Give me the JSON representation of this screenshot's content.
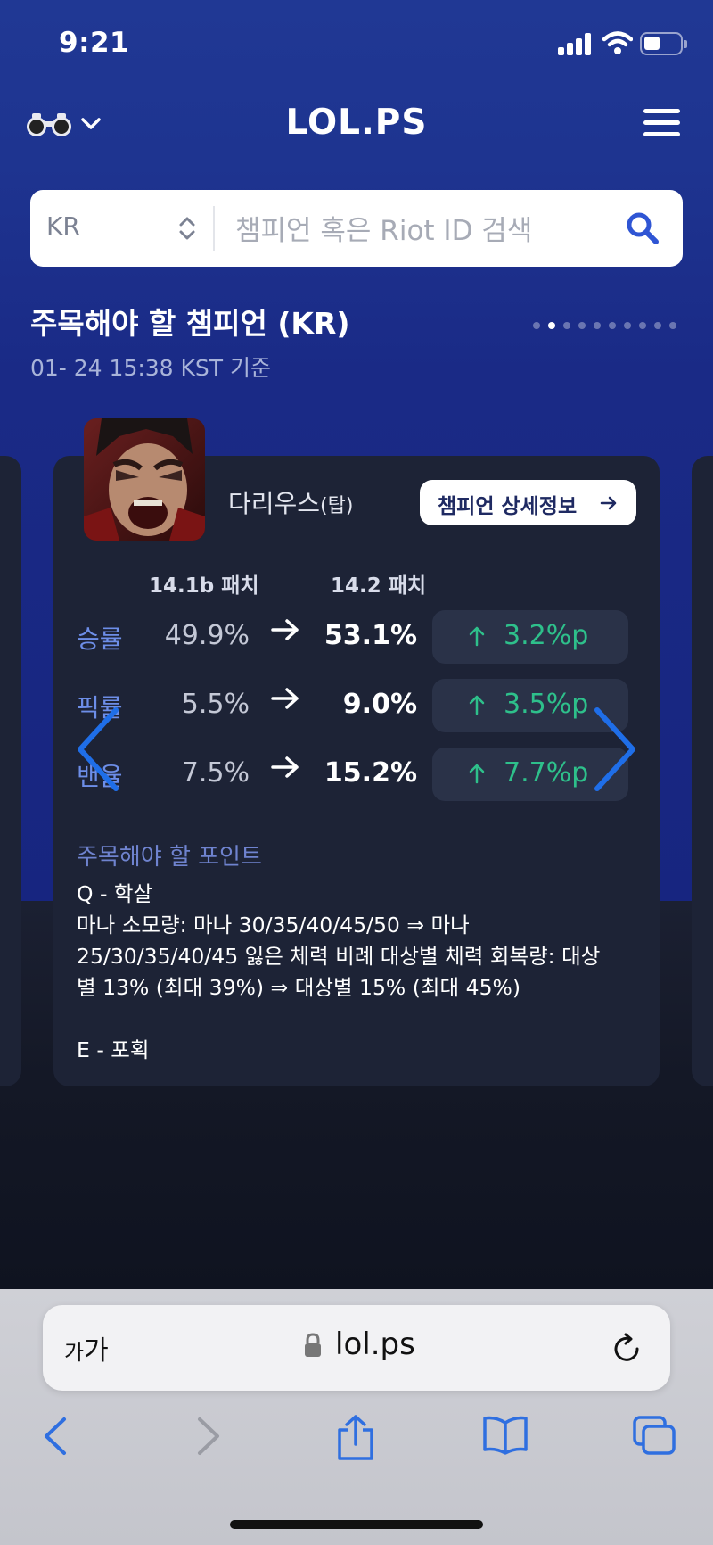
{
  "status_bar": {
    "time": "9:21",
    "battery_percent": 40
  },
  "header": {
    "logo": "LOL.PS",
    "icons": [
      "binoculars-icon",
      "chevron-down-icon",
      "menu-icon"
    ]
  },
  "search": {
    "region": "KR",
    "placeholder": "챔피언 혹은 Riot ID 검색"
  },
  "section": {
    "title": "주목해야 할 챔피언 (KR)",
    "updated": "01- 24 15:38 KST 기준",
    "page_dots": 10,
    "active_dot": 2
  },
  "card": {
    "champion_name": "다리우스",
    "champion_role": "(탑)",
    "detail_button": "챔피언 상세정보",
    "patch_old": "14.1b 패치",
    "patch_new": "14.2 패치",
    "stats": [
      {
        "label": "승률",
        "old": "49.9%",
        "new": "53.1%",
        "delta": "3.2%p"
      },
      {
        "label": "픽률",
        "old": "5.5%",
        "new": "9.0%",
        "delta": "3.5%p"
      },
      {
        "label": "밴율",
        "old": "7.5%",
        "new": "15.2%",
        "delta": "7.7%p"
      }
    ],
    "points_title": "주목해야 할 포인트",
    "notes": [
      "Q - 학살",
      "마나 소모량: 마나 30/35/40/45/50 ⇒ 마나",
      "25/30/35/40/45 잃은 체력 비례 대상별 체력 회복량: 대상",
      "별 13% (최대 39%) ⇒ 대상별 15% (최대 45%)",
      "",
      "E - 포획"
    ]
  },
  "browser": {
    "text_size_button": "가가",
    "url": "lol.ps"
  },
  "colors": {
    "accent_blue": "#203894",
    "card_bg": "#1d2336",
    "positive_green": "#2ec08b",
    "label_blue": "#6d8ee8",
    "nav_arrow_blue": "#1f6ee8"
  }
}
